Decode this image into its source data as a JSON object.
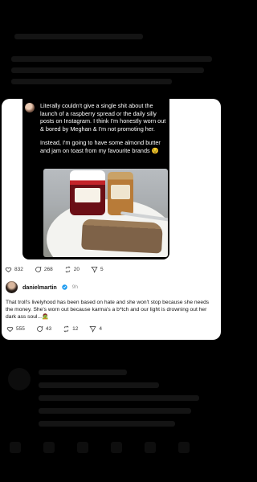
{
  "embedded_post": {
    "text_p1": "Literally couldn't give a single shit about the launch of a raspberry spread or the daily silly posts on Instagram. I think I'm honestly worn out & bored by Meghan & I'm not promoting her.",
    "text_p2": "Instead, I'm going to have some almond butter and jam on toast from my favourite brands 😉",
    "actions": {
      "likes": "832",
      "replies": "268",
      "reposts": "20",
      "shares": "5"
    }
  },
  "reply": {
    "username": "danielmartin",
    "time": "9h",
    "text": "That troll's livelyhood has been based on hate and she won't stop because she needs the money. She's worn out because karma's a b*tch and our light is drowning out her dark ass soul...🧟",
    "actions": {
      "likes": "555",
      "replies": "43",
      "reposts": "12",
      "shares": "4"
    }
  },
  "colors": {
    "background": "#000000",
    "card": "#ffffff",
    "verified": "#1d9bf0"
  }
}
